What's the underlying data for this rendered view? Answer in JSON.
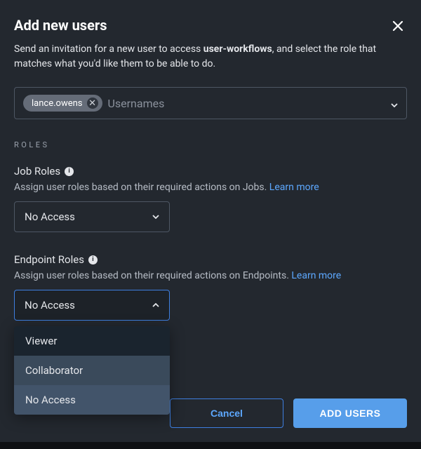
{
  "header": {
    "title": "Add new users"
  },
  "description": {
    "prefix": "Send an invitation for a new user to access ",
    "bold": "user-workflows",
    "suffix": ", and select the role that matches what you'd like them to be able to do."
  },
  "usernames_field": {
    "chips": [
      "lance.owens"
    ],
    "placeholder": "Usernames"
  },
  "roles_section_label": "ROLES",
  "job_roles": {
    "label": "Job Roles",
    "helper_text": "Assign user roles based on their required actions on Jobs. ",
    "learn_more": "Learn more",
    "selected": "No Access"
  },
  "endpoint_roles": {
    "label": "Endpoint Roles",
    "helper_text": "Assign user roles based on their required actions on Endpoints. ",
    "learn_more": "Learn more",
    "selected": "No Access",
    "options": [
      "Viewer",
      "Collaborator",
      "No Access"
    ]
  },
  "footer": {
    "cancel": "Cancel",
    "submit": "ADD USERS"
  }
}
